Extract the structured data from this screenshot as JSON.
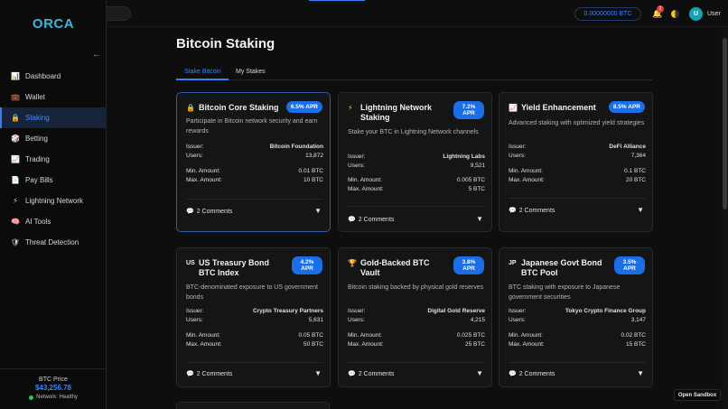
{
  "sidebar": {
    "logo": "ORCA",
    "collapse_icon": "arrow-left-icon",
    "items": [
      {
        "label": "Dashboard",
        "icon": "📊"
      },
      {
        "label": "Wallet",
        "icon": "💼"
      },
      {
        "label": "Staking",
        "icon": "🔒"
      },
      {
        "label": "Betting",
        "icon": "🎲"
      },
      {
        "label": "Trading",
        "icon": "📈"
      },
      {
        "label": "Pay Bills",
        "icon": "📄"
      },
      {
        "label": "Lightning Network",
        "icon": "⚡"
      },
      {
        "label": "AI Tools",
        "icon": "🧠"
      },
      {
        "label": "Threat Detection",
        "icon": "🛡"
      }
    ],
    "active_index": 2,
    "btc_price_label": "BTC Price",
    "btc_price_value": "$43,256.78",
    "network_status": "Network: Healthy"
  },
  "topbar": {
    "balance": "0.00000000 BTC",
    "notification_count": "2",
    "avatar_letter": "U",
    "user_label": "User"
  },
  "main": {
    "title": "Bitcoin Staking",
    "tabs": [
      {
        "label": "Stake Bitcoin"
      },
      {
        "label": "My Stakes"
      }
    ],
    "active_tab": 0
  },
  "labels": {
    "issuer": "Issuer:",
    "users": "Users:",
    "min": "Min. Amount:",
    "max": "Max. Amount:"
  },
  "cards": [
    {
      "icon": "🔒",
      "title": "Bitcoin Core Staking",
      "apr": "6.5% APR",
      "desc": "Participate in Bitcoin network security and earn rewards",
      "issuer": "Bitcoin Foundation",
      "users": "13,872",
      "min": "0.01 BTC",
      "max": "10 BTC",
      "comments": "2 Comments"
    },
    {
      "icon": "⚡",
      "title": "Lightning Network Staking",
      "apr": "7.2% APR",
      "desc": "Stake your BTC in Lightning Network channels",
      "issuer": "Lightning Labs",
      "users": "9,521",
      "min": "0.005 BTC",
      "max": "5 BTC",
      "comments": "2 Comments"
    },
    {
      "icon": "📈",
      "title": "Yield Enhancement",
      "apr": "8.5% APR",
      "desc": "Advanced staking with optimized yield strategies",
      "issuer": "DeFi Alliance",
      "users": "7,364",
      "min": "0.1 BTC",
      "max": "20 BTC",
      "comments": "2 Comments"
    },
    {
      "icon": "US",
      "title": "US Treasury Bond BTC Index",
      "apr": "4.2% APR",
      "desc": "BTC-denominated exposure to US government bonds",
      "issuer": "Crypto Treasury Partners",
      "users": "5,631",
      "min": "0.05 BTC",
      "max": "50 BTC",
      "comments": "2 Comments"
    },
    {
      "icon": "🏆",
      "title": "Gold-Backed BTC Vault",
      "apr": "3.8% APR",
      "desc": "Bitcoin staking backed by physical gold reserves",
      "issuer": "Digital Gold Reserve",
      "users": "4,215",
      "min": "0.025 BTC",
      "max": "25 BTC",
      "comments": "2 Comments"
    },
    {
      "icon": "JP",
      "title": "Japanese Govt Bond BTC Pool",
      "apr": "3.5% APR",
      "desc": "BTC staking with exposure to Japanese government securities",
      "issuer": "Tokyo Crypto Finance Group",
      "users": "3,147",
      "min": "0.02 BTC",
      "max": "15 BTC",
      "comments": "2 Comments"
    }
  ],
  "sandbox_label": "Open Sandbox",
  "colors": {
    "accent": "#3b82f6",
    "logo": "#36b7d9",
    "apr_badge": "#1a6fe8",
    "healthy": "#22c55e"
  }
}
